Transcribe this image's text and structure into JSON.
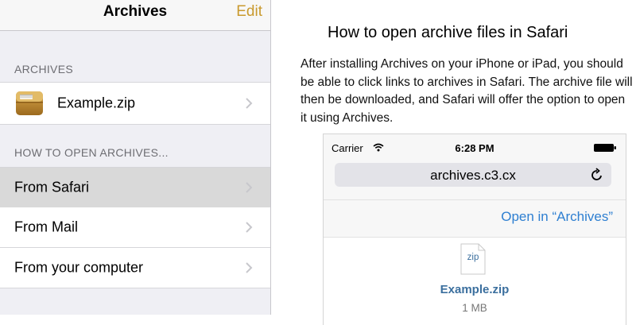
{
  "navbar": {
    "title": "Archives",
    "edit_label": "Edit"
  },
  "sections": {
    "archives_header": "ARCHIVES",
    "archive_item": {
      "label": "Example.zip",
      "icon": "zip-archive-icon"
    },
    "how_to_header": "HOW TO OPEN ARCHIVES...",
    "how_to_items": [
      {
        "label": "From Safari",
        "selected": true
      },
      {
        "label": "From Mail",
        "selected": false
      },
      {
        "label": "From your computer",
        "selected": false
      }
    ]
  },
  "detail": {
    "title": "How to open archive files in Safari",
    "body": "After installing Archives on your iPhone or iPad, you should be able to click links to archives in Safari. The archive file will then be downloaded, and Safari will offer the option to open it using Archives.",
    "phone": {
      "carrier": "Carrier",
      "time": "6:28 PM",
      "url": "archives.c3.cx",
      "open_in": "Open in “Archives”",
      "file_ext": "zip",
      "file_name": "Example.zip",
      "file_size": "1 MB"
    }
  },
  "colors": {
    "accent_gold": "#c99a2e",
    "link_blue": "#2e7fd1",
    "file_name_blue": "#3b6f9e",
    "selected_row": "#d9d9d9"
  }
}
